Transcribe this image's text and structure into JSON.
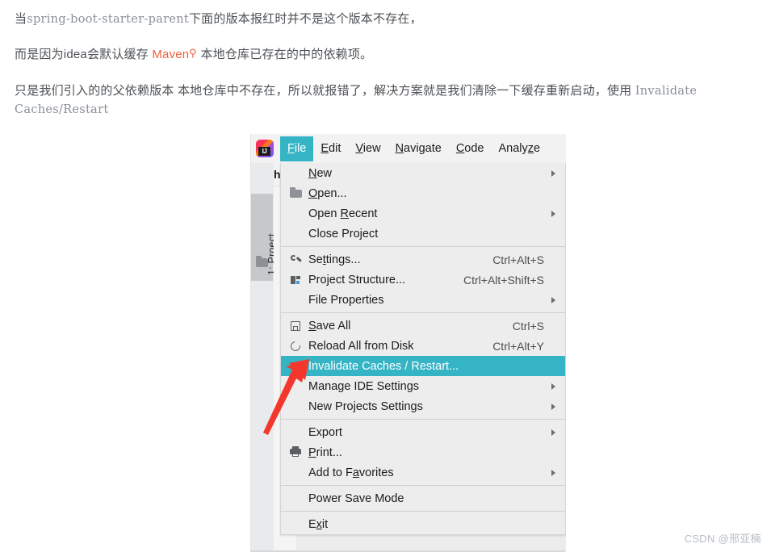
{
  "article": {
    "paragraphs": [
      {
        "id": "p1",
        "segments": [
          {
            "type": "text",
            "text": "当"
          },
          {
            "type": "code",
            "text": "spring-boot-starter-parent"
          },
          {
            "type": "text",
            "text": "下面的版本报红时并不是这个版本不存在，"
          }
        ]
      },
      {
        "id": "p2",
        "segments": [
          {
            "type": "text",
            "text": "而是因为idea会默认缓存 "
          },
          {
            "type": "link",
            "text": "Maven",
            "color": "#f2603c",
            "icon": "search-icon"
          },
          {
            "type": "text",
            "text": " 本地仓库已存在的中的依赖项。"
          }
        ]
      },
      {
        "id": "p3",
        "segments": [
          {
            "type": "text",
            "text": "只是我们引入的的父依赖版本 本地仓库中不存在，所以就报错了，解决方案就是我们清除一下缓存重新启动，使用 "
          },
          {
            "type": "code",
            "text": "Invalidate Caches/Restart"
          }
        ]
      }
    ],
    "p1_prefix": "当",
    "p1_code": "spring-boot-starter-parent",
    "p1_suffix": "下面的版本报红时并不是这个版本不存在，",
    "p2_prefix": "而是因为idea会默认缓存 ",
    "p2_link": "Maven",
    "p2_suffix": " 本地仓库已存在的中的依赖项。",
    "p3_text": "只是我们引入的的父依赖版本 本地仓库中不存在，所以就报错了，解决方案就是我们清除一下缓存重新启动，使用 ",
    "p3_code": "Invalidate",
    "p3_code2": "Caches/Restart"
  },
  "ide": {
    "app_logo": "intellij-idea-logo",
    "menubar": [
      {
        "label_before": "",
        "mnemonic": "F",
        "label_after": "ile",
        "active": true
      },
      {
        "label_before": "",
        "mnemonic": "E",
        "label_after": "dit",
        "active": false
      },
      {
        "label_before": "",
        "mnemonic": "V",
        "label_after": "iew",
        "active": false
      },
      {
        "label_before": "",
        "mnemonic": "N",
        "label_after": "avigate",
        "active": false
      },
      {
        "label_before": "",
        "mnemonic": "C",
        "label_after": "ode",
        "active": false
      },
      {
        "label_before": "Analy",
        "mnemonic": "z",
        "label_after": "e",
        "active": false
      }
    ],
    "menubar_labels": {
      "file": "File",
      "edit": "Edit",
      "view": "View",
      "navigate": "Navigate",
      "code": "Code",
      "analyze": "Analyze"
    },
    "project_name": "hel",
    "tool_tab": {
      "number": "1",
      "label": "Project",
      "full": "1: Project"
    },
    "file_menu": [
      {
        "icon": null,
        "label_before": "",
        "mnemonic": "N",
        "label_after": "ew",
        "accel": "",
        "submenu": true,
        "selected": false
      },
      {
        "icon": "folder-icon",
        "label_before": "",
        "mnemonic": "O",
        "label_after": "pen...",
        "accel": "",
        "submenu": false,
        "selected": false
      },
      {
        "icon": null,
        "label_before": "Open ",
        "mnemonic": "R",
        "label_after": "ecent",
        "accel": "",
        "submenu": true,
        "selected": false
      },
      {
        "icon": null,
        "label_before": "Close Project",
        "mnemonic": "",
        "label_after": "",
        "accel": "",
        "submenu": false,
        "selected": false
      },
      {
        "separator": true
      },
      {
        "icon": "wrench-icon",
        "label_before": "Se",
        "mnemonic": "t",
        "label_after": "tings...",
        "accel": "Ctrl+Alt+S",
        "submenu": false,
        "selected": false
      },
      {
        "icon": "project-structure-icon",
        "label_before": "Project Structure...",
        "mnemonic": "",
        "label_after": "",
        "accel": "Ctrl+Alt+Shift+S",
        "submenu": false,
        "selected": false
      },
      {
        "icon": null,
        "label_before": "File Properties",
        "mnemonic": "",
        "label_after": "",
        "accel": "",
        "submenu": true,
        "selected": false
      },
      {
        "separator": true
      },
      {
        "icon": "save-icon",
        "label_before": "",
        "mnemonic": "S",
        "label_after": "ave All",
        "accel": "Ctrl+S",
        "submenu": false,
        "selected": false
      },
      {
        "icon": "reload-icon",
        "label_before": "Reload All from Disk",
        "mnemonic": "",
        "label_after": "",
        "accel": "Ctrl+Alt+Y",
        "submenu": false,
        "selected": false
      },
      {
        "icon": null,
        "label_before": "Invalidate Caches / Restart...",
        "mnemonic": "",
        "label_after": "",
        "accel": "",
        "submenu": false,
        "selected": true
      },
      {
        "icon": null,
        "label_before": "Manage IDE Settings",
        "mnemonic": "",
        "label_after": "",
        "accel": "",
        "submenu": true,
        "selected": false
      },
      {
        "icon": null,
        "label_before": "New Projects Settings",
        "mnemonic": "",
        "label_after": "",
        "accel": "",
        "submenu": true,
        "selected": false
      },
      {
        "separator": true
      },
      {
        "icon": null,
        "label_before": "Export",
        "mnemonic": "",
        "label_after": "",
        "accel": "",
        "submenu": true,
        "selected": false
      },
      {
        "icon": "print-icon",
        "label_before": "",
        "mnemonic": "P",
        "label_after": "rint...",
        "accel": "",
        "submenu": false,
        "selected": false
      },
      {
        "icon": null,
        "label_before": "Add to F",
        "mnemonic": "a",
        "label_after": "vorites",
        "accel": "",
        "submenu": true,
        "selected": false
      },
      {
        "separator": true
      },
      {
        "icon": null,
        "label_before": "Power Save Mode",
        "mnemonic": "",
        "label_after": "",
        "accel": "",
        "submenu": false,
        "selected": false
      },
      {
        "separator": true
      },
      {
        "icon": null,
        "label_before": "E",
        "mnemonic": "x",
        "label_after": "it",
        "accel": "",
        "submenu": false,
        "selected": false
      }
    ],
    "labels": {
      "new": "New",
      "open": "Open...",
      "open_recent": "Open Recent",
      "close_project": "Close Project",
      "settings": "Settings...",
      "settings_accel": "Ctrl+Alt+S",
      "project_structure": "Project Structure...",
      "project_structure_accel": "Ctrl+Alt+Shift+S",
      "file_properties": "File Properties",
      "save_all": "Save All",
      "save_all_accel": "Ctrl+S",
      "reload_all": "Reload All from Disk",
      "reload_all_accel": "Ctrl+Alt+Y",
      "invalidate": "Invalidate Caches / Restart...",
      "manage_ide": "Manage IDE Settings",
      "new_projects": "New Projects Settings",
      "export": "Export",
      "print": "Print...",
      "favorites": "Add to Favorites",
      "power_save": "Power Save Mode",
      "exit": "Exit"
    },
    "annotation": {
      "type": "red-arrow",
      "color": "#f4372c",
      "points_at": "Invalidate Caches / Restart..."
    },
    "colors": {
      "selection": "#35b4c6",
      "menu_bg": "#ededed",
      "menubar_bg": "#f2f2f2",
      "arrow_red": "#f4372c"
    }
  },
  "watermark": "CSDN @邢亚楠"
}
